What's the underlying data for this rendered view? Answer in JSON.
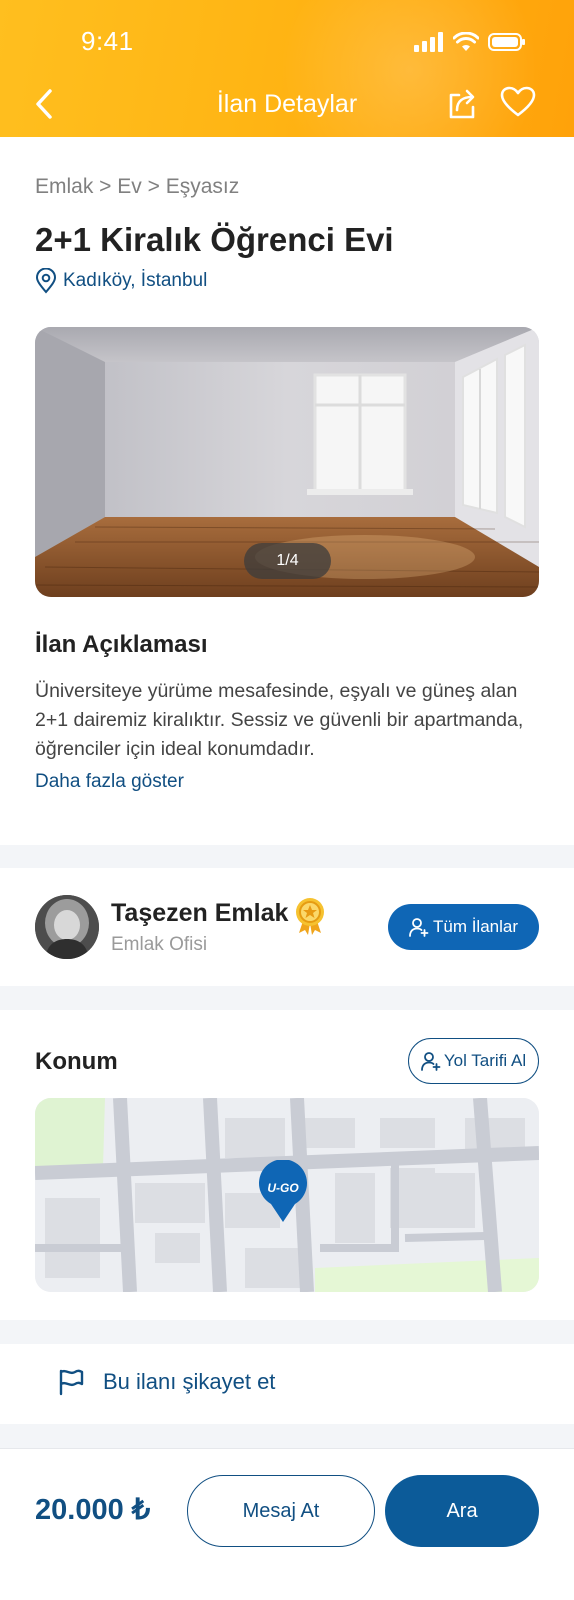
{
  "status_bar": {
    "time": "9:41"
  },
  "header": {
    "title": "İlan Detaylar"
  },
  "listing": {
    "breadcrumb": "Emlak > Ev > Eşyasız",
    "title": "2+1 Kiralık Öğrenci Evi",
    "location": "Kadıköy, İstanbul",
    "photo_counter": "1/4",
    "description_title": "İlan Açıklaması",
    "description": "Üniversiteye yürüme mesafesinde, eşyalı ve güneş alan 2+1 dairemiz kiralıktır. Sessiz ve güvenli bir apartmanda, öğrenciler için ideal konumdadır.",
    "show_more": "Daha fazla göster"
  },
  "agent": {
    "name": "Taşezen Emlak",
    "type": "Emlak Ofisi",
    "all_listings_label": "Tüm İlanlar"
  },
  "location_section": {
    "title": "Konum",
    "directions_label": "Yol Tarifi Al",
    "pin_logo": "U-GO"
  },
  "report": {
    "label": "Bu ilanı şikayet et"
  },
  "bottom_bar": {
    "price": "20.000 ₺",
    "message_label": "Mesaj At",
    "call_label": "Ara"
  },
  "colors": {
    "header": "#ffb514",
    "primary": "#0f66b5",
    "link": "#114f82"
  }
}
